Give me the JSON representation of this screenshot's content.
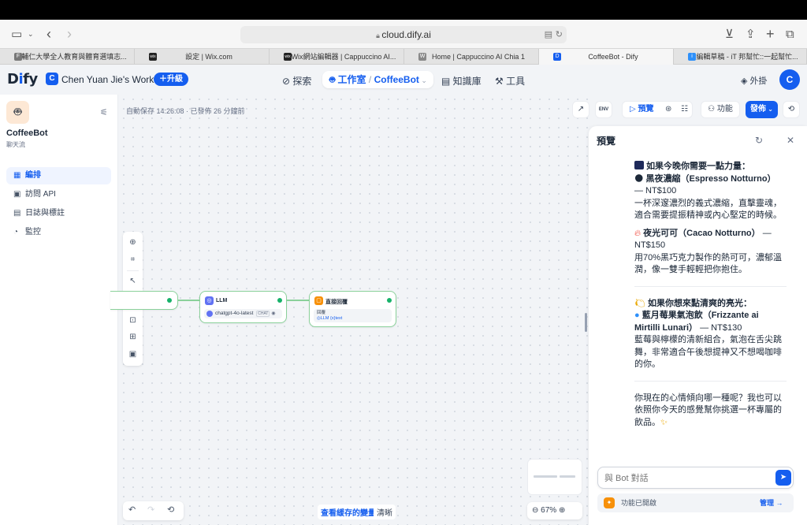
{
  "safari": {
    "url": "cloud.dify.ai",
    "tabs": [
      {
        "label": "輔仁大學全人教育與體育選填志...",
        "favicon": "F"
      },
      {
        "label": "設定 | Wix.com",
        "favicon": "wix"
      },
      {
        "label": "Wix網站編輯器 | Cappuccino AI...",
        "favicon": "wix"
      },
      {
        "label": "Home | Cappuccino AI Chia 1",
        "favicon": "W"
      },
      {
        "label": "CoffeeBot - Dify",
        "favicon": "dify"
      },
      {
        "label": "編輯草稿 - iT 邦幫忙::一起幫忙...",
        "favicon": "it"
      }
    ]
  },
  "header": {
    "logo_prefix": "D",
    "logo_i": "i",
    "logo_suffix": "fy",
    "workspace_initial": "C",
    "workspace_name": "Chen Yuan Jie's Work...",
    "upgrade": "升級",
    "nav": {
      "explore": "探索",
      "studio": "工作室",
      "app_crumb": "CoffeeBot",
      "knowledge": "知識庫",
      "tools": "工具"
    },
    "plugins": "外掛",
    "user_initial": "C"
  },
  "sidebar": {
    "app_name": "CoffeeBot",
    "app_type": "聊天流",
    "items": [
      {
        "label": "編排",
        "icon": "layout-icon"
      },
      {
        "label": "訪問 API",
        "icon": "terminal-icon"
      },
      {
        "label": "日誌與標註",
        "icon": "file-icon"
      },
      {
        "label": "監控",
        "icon": "gauge-icon"
      }
    ]
  },
  "canvas": {
    "autosave": "自動保存 14:26:08 · 已發佈 26 分鐘前",
    "llm_node": {
      "title": "LLM",
      "model": "chatgpt-4o-latest",
      "model_badge": "CHAT"
    },
    "answer_node": {
      "title": "直接回覆",
      "field_label": "回覆",
      "var_source": "LLM",
      "var_name": "{x}text"
    },
    "view_cache": "查看緩存的變量",
    "clear": "清晰",
    "zoom": "67%"
  },
  "toolbar": {
    "env": "ENV",
    "preview": "預覽",
    "features": "功能",
    "publish": "發佈"
  },
  "preview": {
    "title": "預覽",
    "msg": {
      "intro1": "如果今晚你需要一點力量：",
      "item1_name": "黑夜濃縮（Espresso Notturno）",
      "item1_price": "— NT$100",
      "item1_desc": "一杯深邃濃烈的義式濃縮，直擊靈魂，適合需要提振精神或內心堅定的時候。",
      "item2_name": "夜光可可（Cacao Notturno）",
      "item2_price": "— NT$150",
      "item2_desc": "用70%黑巧克力製作的熱可可，濃郁溫潤，像一雙手輕輕把你抱住。",
      "intro2": "如果你想來點清爽的亮光：",
      "item3_name": "藍月莓果氣泡飲（Frizzante ai Mirtilli Lunari）",
      "item3_price": "— NT$130",
      "item3_desc": "藍莓與檸檬的清新組合，氣泡在舌尖跳舞，非常適合午後想提神又不想喝咖啡的你。",
      "closing": "你現在的心情傾向哪一種呢？我也可以依照你今天的感覺幫你挑選一杯專屬的飲品。"
    },
    "input_placeholder": "與 Bot 對話",
    "features_enabled": "功能已開啟",
    "manage": "管理"
  },
  "colors": {
    "accent": "#155eef",
    "node_border": "#8bd19b",
    "ok": "#17b26a"
  }
}
